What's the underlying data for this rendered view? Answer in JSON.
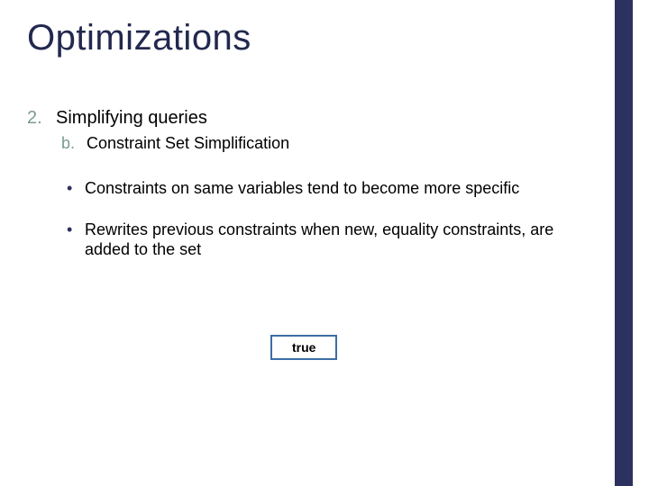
{
  "title": "Optimizations",
  "outer": {
    "num": "2.",
    "text": "Simplifying queries"
  },
  "inner": {
    "num": "b.",
    "text": "Constraint Set Simplification"
  },
  "bullets": {
    "b1": "Constraints on same variables tend to become more specific",
    "b2": "Rewrites previous constraints when new, equality constraints, are added to the set"
  },
  "box": "true"
}
